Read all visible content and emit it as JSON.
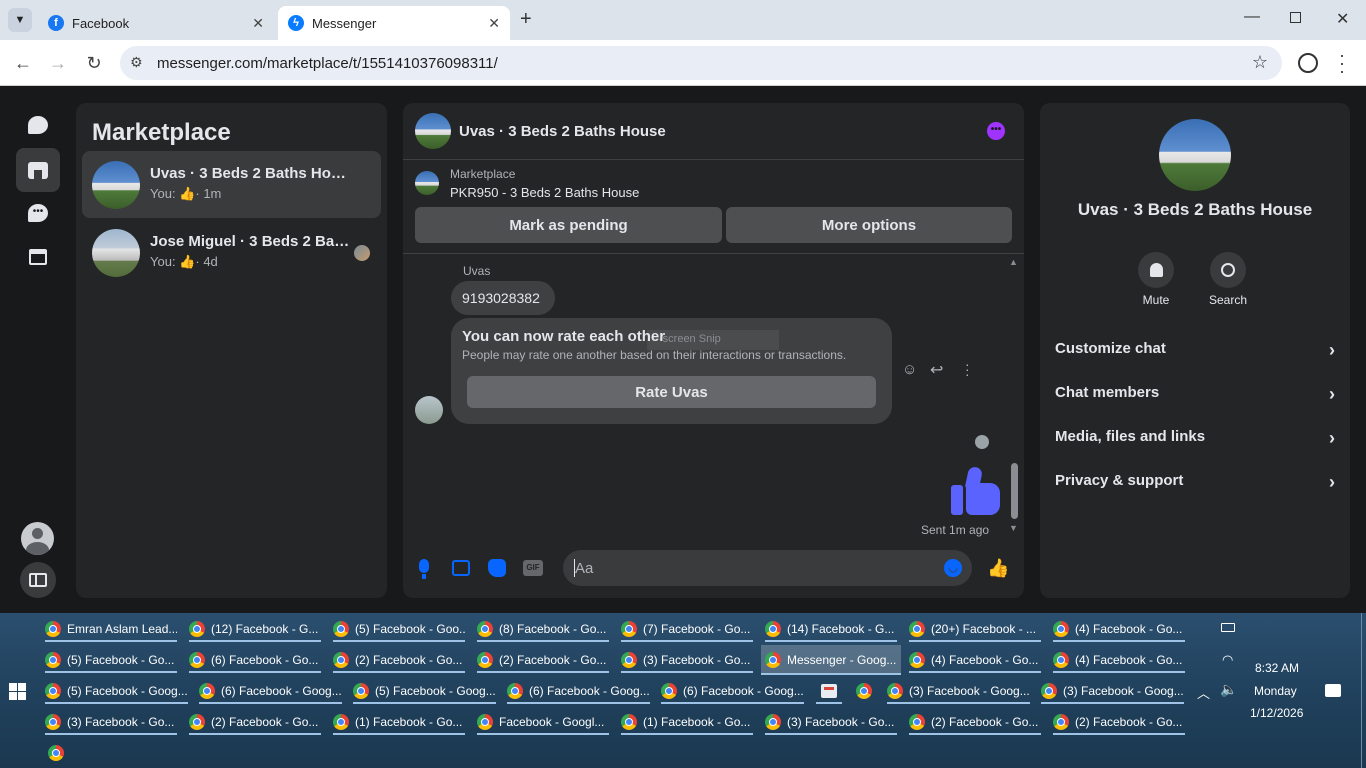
{
  "browser": {
    "tabs": [
      {
        "title": "Facebook",
        "favicon": "facebook-icon",
        "active": false
      },
      {
        "title": "Messenger",
        "favicon": "messenger-icon",
        "active": true
      }
    ],
    "new_tab": "+",
    "window_controls": [
      "minimize-icon",
      "restore-icon",
      "close-icon"
    ],
    "url": "messenger.com/marketplace/t/1551410376098311/"
  },
  "left_panel": {
    "title": "Marketplace",
    "conversations": [
      {
        "title": "Uvas · 3 Beds 2 Baths House",
        "preview_prefix": "You:",
        "preview_icon": "thumbs-up-icon",
        "time": "· 1m",
        "selected": true
      },
      {
        "title": "Jose Miguel · 3 Beds 2 Bat...",
        "preview_prefix": "You:",
        "preview_icon": "thumbs-up-icon",
        "time": "· 4d",
        "selected": false
      }
    ]
  },
  "chat": {
    "title": "Uvas · 3 Beds 2 Baths House",
    "listing_source": "Marketplace",
    "listing_price_title": "PKR950 - 3 Beds 2 Baths House",
    "mark_pending": "Mark as pending",
    "more_options": "More options",
    "sender_name": "Uvas",
    "message_phone": "9193028382",
    "rate_title": "You can now rate each other",
    "rate_body": "People may rate one another based on their interactions or transactions.",
    "rate_ghost": "-screen Snip",
    "rate_button": "Rate Uvas",
    "sent_status": "Sent 1m ago",
    "composer_placeholder": "Aa",
    "gif_label": "GIF"
  },
  "right_panel": {
    "title": "Uvas · 3 Beds 2 Baths House",
    "actions": [
      {
        "label": "Mute",
        "icon": "bell-icon"
      },
      {
        "label": "Search",
        "icon": "search-icon"
      }
    ],
    "sections": [
      "Customize chat",
      "Chat members",
      "Media, files and links",
      "Privacy & support"
    ]
  },
  "taskbar": {
    "rows": [
      [
        "Emran Aslam Lead...",
        "(12) Facebook - G...",
        "(5) Facebook - Goo...",
        "(8) Facebook - Go...",
        "(7) Facebook - Go...",
        "(14) Facebook - G...",
        "(20+) Facebook - ...",
        "(4) Facebook - Go..."
      ],
      [
        "(5) Facebook - Go...",
        "(6) Facebook - Go...",
        "(2) Facebook - Go...",
        "(2) Facebook - Go...",
        "(3) Facebook - Go...",
        "Messenger - Goog...",
        "(4) Facebook - Go...",
        "(4) Facebook - Go..."
      ],
      [
        "(5) Facebook - Goog...",
        "(6) Facebook - Goog...",
        "(5) Facebook - Goog...",
        "(6) Facebook - Goog...",
        "(6) Facebook - Goog...",
        "",
        "",
        "(3) Facebook - Goog...",
        "(3) Facebook - Goog..."
      ],
      [
        "(3) Facebook - Go...",
        "(2) Facebook - Go...",
        "(1) Facebook - Go...",
        "Facebook - Googl...",
        "(1) Facebook - Go...",
        "(3) Facebook - Go...",
        "(2) Facebook - Go...",
        "(2) Facebook - Go..."
      ]
    ],
    "time": "8:32 AM",
    "day": "Monday",
    "date": "1/12/2026"
  },
  "colors": {
    "accent": "#0866ff",
    "like": "#5b63ff",
    "purple": "#a033ff"
  }
}
